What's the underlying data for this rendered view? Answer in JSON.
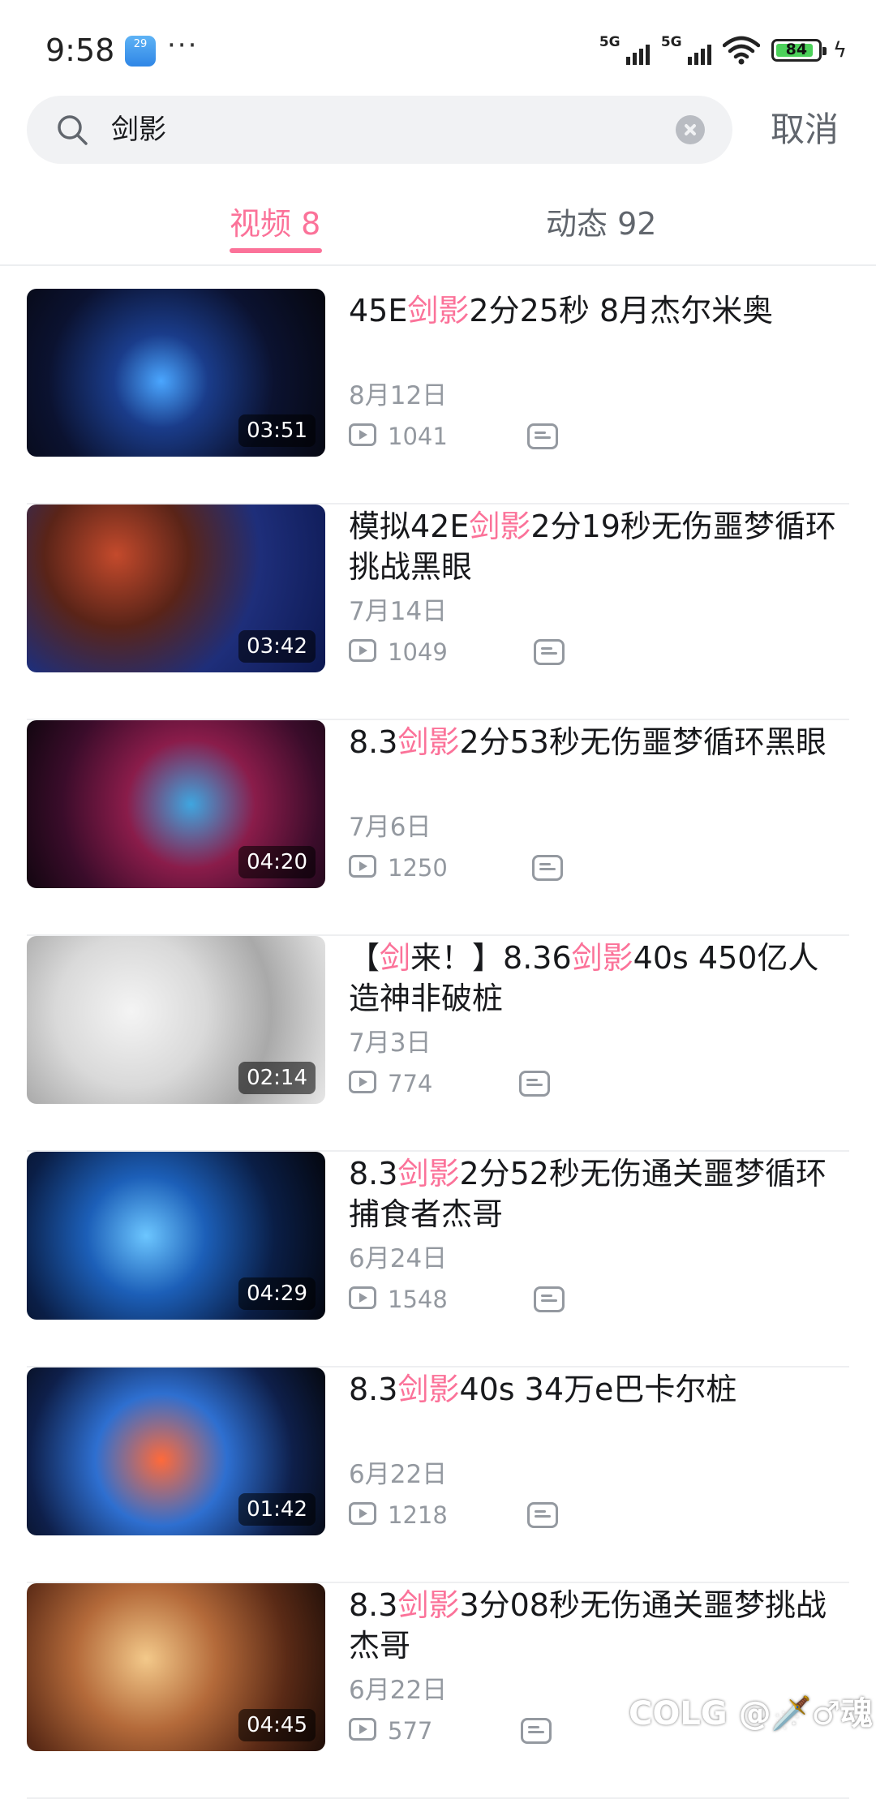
{
  "status": {
    "time": "9:58",
    "weather_badge": "29",
    "dots": "···",
    "signal1": "5G",
    "signal2": "5G",
    "battery": "84"
  },
  "search": {
    "query": "剑影",
    "cancel_label": "取消"
  },
  "tabs": [
    {
      "label": "视频 8"
    },
    {
      "label": "动态 92"
    }
  ],
  "videos": [
    {
      "pre": "45E",
      "hl": "剑影",
      "post": "2分25秒 8月杰尔米奥",
      "date": "8月12日",
      "views": "1041",
      "duration": "03:51"
    },
    {
      "pre": "模拟42E",
      "hl": "剑影",
      "post": "2分19秒无伤噩梦循环挑战黑眼",
      "date": "7月14日",
      "views": "1049",
      "duration": "03:42"
    },
    {
      "pre": "8.3",
      "hl": "剑影",
      "post": "2分53秒无伤噩梦循环黑眼",
      "date": "7月6日",
      "views": "1250",
      "duration": "04:20"
    },
    {
      "pre": "【",
      "hl": "剑",
      "post": "来！】8.36",
      "hl2": "剑影",
      "post2": "40s 450亿人造神非破桩",
      "date": "7月3日",
      "views": "774",
      "duration": "02:14"
    },
    {
      "pre": "8.3",
      "hl": "剑影",
      "post": "2分52秒无伤通关噩梦循环捕食者杰哥",
      "date": "6月24日",
      "views": "1548",
      "duration": "04:29"
    },
    {
      "pre": "8.3",
      "hl": "剑影",
      "post": "40s 34万e巴卡尔桩",
      "date": "6月22日",
      "views": "1218",
      "duration": "01:42"
    },
    {
      "pre": "8.3",
      "hl": "剑影",
      "post": "3分08秒无伤通关噩梦挑战杰哥",
      "date": "6月22日",
      "views": "577",
      "duration": "04:45"
    }
  ],
  "watermark": "COLG @🗡️♂魂",
  "colors": {
    "accent": "#fb7299",
    "secondary_text": "#9499a0"
  }
}
